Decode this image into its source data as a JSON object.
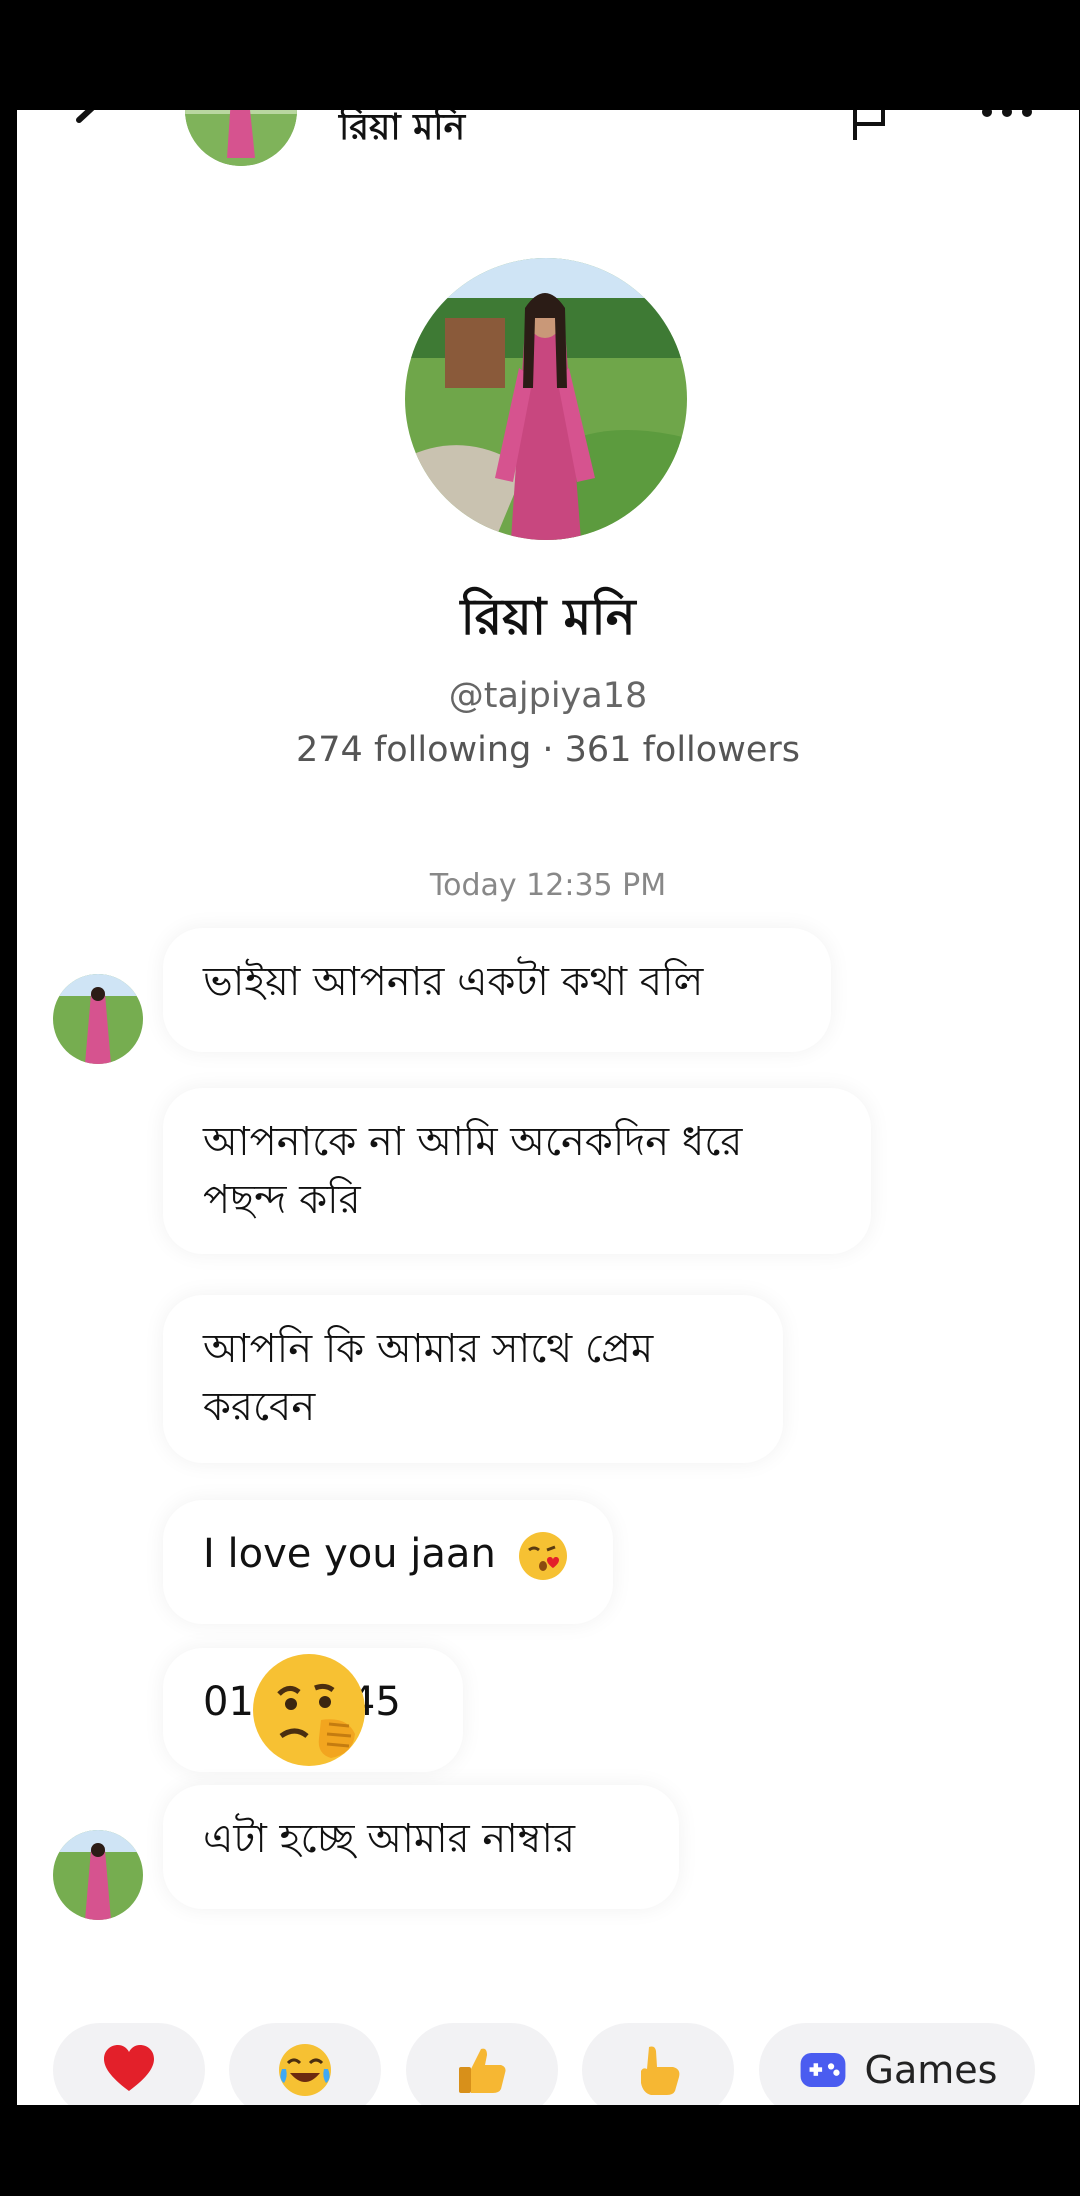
{
  "header": {
    "name": "রিয়া মনি"
  },
  "profile": {
    "name": "রিয়া মনি",
    "handle": "@tajpiya18",
    "stats": "274 following · 361 followers"
  },
  "conversation": {
    "timestamp": "Today 12:35 PM",
    "messages": [
      "ভাইয়া আপনার একটা কথা বলি",
      "আপনাকে না আমি অনেকদিন ধরে পছন্দ করি",
      "আপনি কি আমার সাথে প্রেম করবেন",
      "I love you jaan",
      "01",
      "45",
      "এটা হচ্ছে আমার নাম্বার"
    ],
    "emojis": [
      "kissing-heart-emoji",
      "peeking-hand-over-mouth-emoji"
    ]
  },
  "reactions": {
    "items": [
      "heart-icon",
      "laughing-emoji-icon",
      "thumbs-up-icon",
      "pointing-hand-icon",
      "games-icon"
    ],
    "games_label": "Games"
  },
  "colors": {
    "background": "#ffffff",
    "frame": "#000000",
    "bubble_shadow": "rgba(0,0,0,0.06)",
    "chip": "#f2f2f4",
    "games_icon": "#4a5cf0",
    "heart": "#e3202a"
  }
}
